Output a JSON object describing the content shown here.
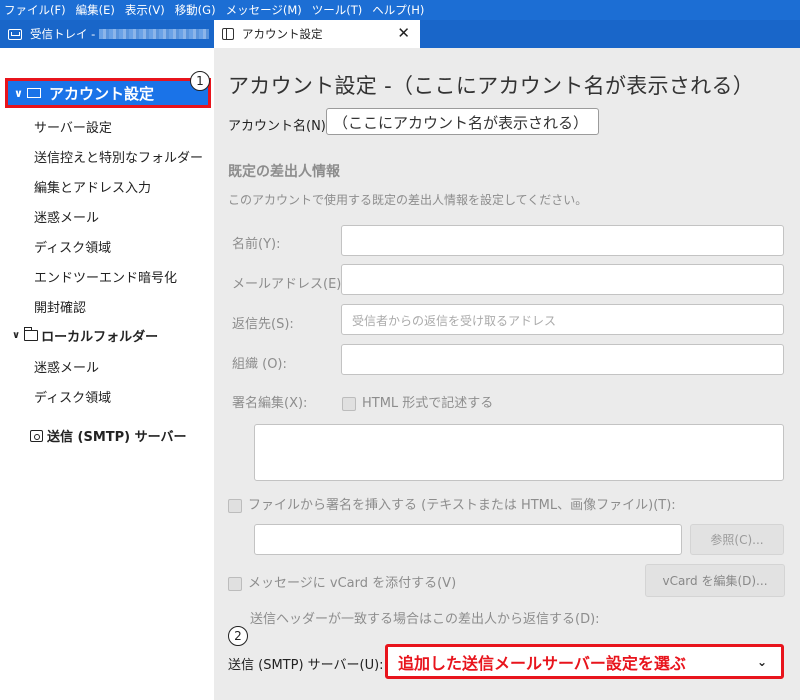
{
  "menubar": {
    "items": [
      "ファイル(F)",
      "編集(E)",
      "表示(V)",
      "移動(G)",
      "メッセージ(M)",
      "ツール(T)",
      "ヘルプ(H)"
    ]
  },
  "tabs": {
    "inbox_label": "受信トレイ -",
    "account_label": "アカウント設定",
    "close_glyph": "✕"
  },
  "sidebar": {
    "account_label": "アカウント設定",
    "items": [
      "サーバー設定",
      "送信控えと特別なフォルダー",
      "編集とアドレス入力",
      "迷惑メール",
      "ディスク領域",
      "エンドツーエンド暗号化",
      "開封確認"
    ],
    "local_folders_label": "ローカルフォルダー",
    "local_items": [
      "迷惑メール",
      "ディスク領域"
    ],
    "smtp_label": "送信 (SMTP) サーバー"
  },
  "badges": {
    "one": "1",
    "two": "2"
  },
  "main": {
    "title": "アカウント設定 -（ここにアカウント名が表示される）",
    "account_name_label": "アカウント名(N):",
    "account_name_value": "（ここにアカウント名が表示される）",
    "identity_title": "既定の差出人情報",
    "identity_desc": "このアカウントで使用する既定の差出人情報を設定してください。",
    "name_label": "名前(Y):",
    "email_label": "メールアドレス(E):",
    "reply_label": "返信先(S):",
    "reply_placeholder": "受信者からの返信を受け取るアドレス",
    "org_label": "組織 (O):",
    "sig_label": "署名編集(X):",
    "sig_html_label": "HTML 形式で記述する",
    "sigfile_label": "ファイルから署名を挿入する (テキストまたは HTML、画像ファイル)(T):",
    "browse_label": "参照(C)...",
    "vcard_label": "メッセージに vCard を添付する(V)",
    "vcard_edit_label": "vCard を編集(D)...",
    "reply_from_label": "送信ヘッダーが一致する場合はこの差出人から返信する(D):",
    "smtp_label": "送信 (SMTP) サーバー(U):",
    "smtp_value": "追加した送信メールサーバー設定を選ぶ",
    "smtp_chevron": "⌄"
  },
  "colors": {
    "accent": "#1a73e8",
    "highlight": "#e8141c",
    "menubar": "#1c6ed4"
  }
}
